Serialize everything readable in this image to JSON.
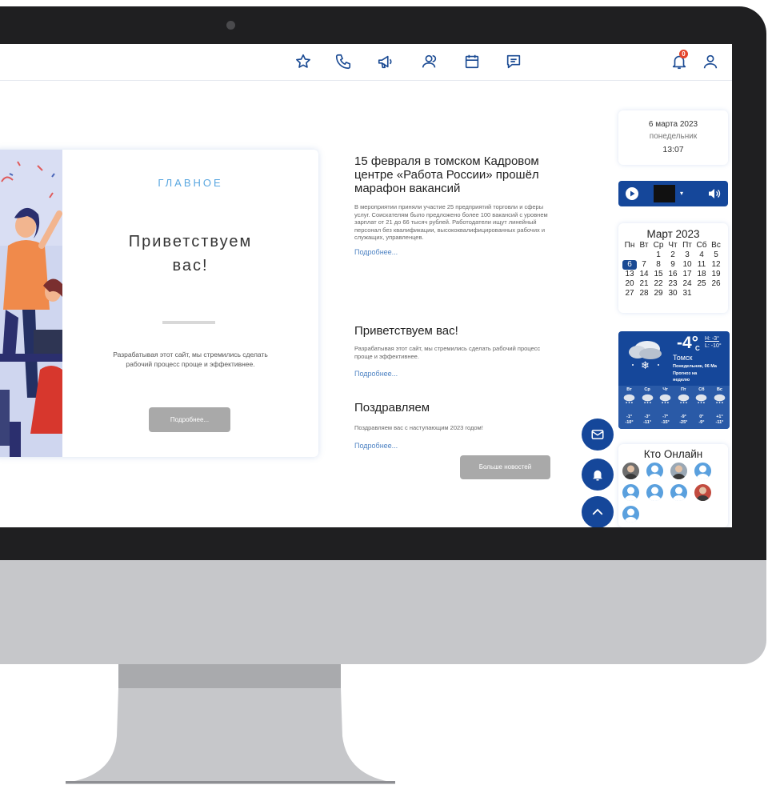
{
  "topbar": {
    "notification_count": "0"
  },
  "hero": {
    "kicker": "ГЛАВНОЕ",
    "title_line1": "Приветствуем",
    "title_line2": "вас!",
    "text": "Разрабатывая этот сайт, мы стремились сделать рабочий процесс проще и эффективнее.",
    "button": "Подробнее..."
  },
  "news": [
    {
      "title": "15 февраля в томском Кадровом центре «Работа России» прошёл марафон вакансий",
      "text": "В мероприятии приняли участие 25 предприятий торговли и сферы услуг. Соискателям было предложено более 100 вакансий с уровнем зарплат от 21 до 66 тысяч рублей. Работодатели ищут линейный персонал без квалификации, высококвалифицированных рабочих и служащих, управленцев.",
      "link": "Подробнее..."
    },
    {
      "title": "Приветствуем вас!",
      "text": "Разрабатывая этот сайт, мы стремились сделать рабочий процесс проще и эффективнее.",
      "link": "Подробнее..."
    },
    {
      "title": "Поздравляем",
      "text": "Поздравляем вас с наступающим 2023 годом!",
      "link": "Подробнее..."
    }
  ],
  "more_news_button": "Больше новостей",
  "date_widget": {
    "date": "6 марта 2023",
    "weekday": "понедельник",
    "time": "13:07"
  },
  "calendar": {
    "title": "Март 2023",
    "weekdays": [
      "Пн",
      "Вт",
      "Ср",
      "Чт",
      "Пт",
      "Сб",
      "Вс"
    ],
    "leading_blanks": 2,
    "days_in_month": 31,
    "today": 6
  },
  "weather": {
    "temp": "-4°",
    "unit": "C",
    "high": "H: -3°",
    "low": "L: -10°",
    "city": "Томск",
    "date_line": "Понедельник, 06 Ма",
    "forecast_label_1": "Прогноз на",
    "forecast_label_2": "неделю",
    "forecast": [
      {
        "day": "Вт",
        "hi": "-1°",
        "lo": "-10°"
      },
      {
        "day": "Ср",
        "hi": "-3°",
        "lo": "-11°"
      },
      {
        "day": "Чт",
        "hi": "-7°",
        "lo": "-15°"
      },
      {
        "day": "Пт",
        "hi": "-9°",
        "lo": "-25°"
      },
      {
        "day": "Сб",
        "hi": "0°",
        "lo": "-9°"
      },
      {
        "day": "Вс",
        "hi": "+1°",
        "lo": "-11°"
      }
    ]
  },
  "online": {
    "title": "Кто Онлайн",
    "users": [
      "photo",
      "default",
      "photo",
      "default",
      "default",
      "default",
      "default",
      "photo",
      "default"
    ]
  },
  "colors": {
    "primary": "#15479a",
    "accent": "#5aa7e0",
    "link": "#4d82c3",
    "badge": "#e4452c"
  }
}
